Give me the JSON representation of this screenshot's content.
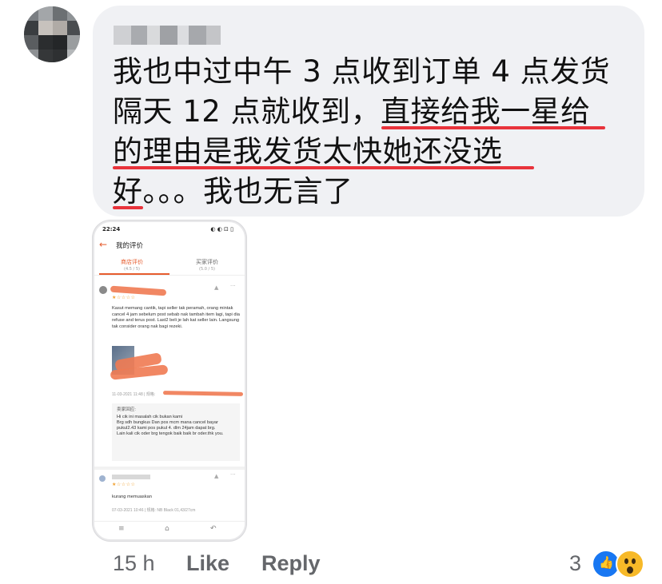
{
  "comment": {
    "lines": [
      "我也中过中午 3 点收到订单 4 点发货",
      "隔天 12 点就收到，直接给我一星给",
      "的理由是我发货太快她还没选",
      "好。。。我也无言了"
    ]
  },
  "screenshot": {
    "status_time": "22:24",
    "status_icons": "◐ ◐ ⊡ ▯",
    "back_icon": "arrow-left-icon",
    "title": "我的评价",
    "tabs": [
      {
        "label": "商店评价",
        "sub": "(4.5 / 5)"
      },
      {
        "label": "买家评价",
        "sub": "(5.0 / 5)"
      }
    ],
    "review1": {
      "stars": "★☆☆☆☆",
      "text": "Kasut memang cantik, tapi seller tak peramah, orang mintak cancel 4 jam sebelum post sebab nak tambah item lagi, tapi dia refuse and terus post. Last2 beli je lah kat seller lain. Langsung tak consider orang nak bagi rezeki.",
      "date": "11-03-2021 11:48 | 规格:",
      "reply_label": "卖家回应:",
      "reply_text": "Hi cik ini masalah cik bukan kami\nBrg sdh bungkus Dan pos mcm mana cancel bayar pukul2.43 kami pos pukul 4. dlm 24jam dapat brg.\nLain kali cik oder brg tengok baik baik br oder.thk you."
    },
    "review2": {
      "stars": "★☆☆☆☆",
      "text": "kurang memuaskan",
      "date": "07-03-2021 10:46 | 规格: NB Black 01,43/27cm"
    },
    "accent_color": "#e65c2e"
  },
  "footer": {
    "time": "15 h",
    "like_label": "Like",
    "reply_label": "Reply",
    "reaction_count": "3"
  },
  "colors": {
    "bubble": "#f0f1f4",
    "underline": "#e8333b",
    "meta_text": "#65676b",
    "like_blue": "#1877f2",
    "wow_yellow": "#f7b928"
  }
}
